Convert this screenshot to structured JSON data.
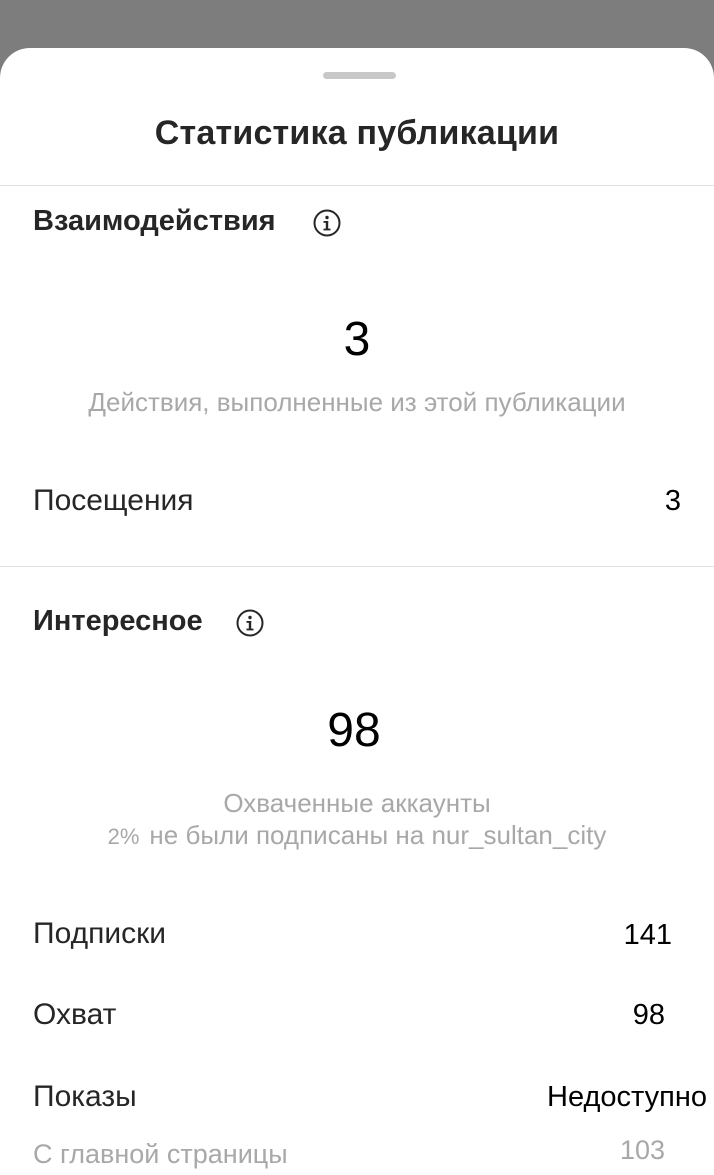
{
  "sheet": {
    "title": "Статистика публикации"
  },
  "interactions": {
    "title": "Взаимодействия",
    "info_icon": "info-circle-icon",
    "total": "3",
    "caption": "Действия, выполненные из этой публикации",
    "rows": [
      {
        "label": "Посещения",
        "value": "3"
      }
    ]
  },
  "discovery": {
    "title": "Интересное",
    "info_icon": "info-circle-icon",
    "total": "98",
    "caption_line1": "Охваченные аккаунты",
    "caption_percent": "2%",
    "caption_line2": "не были подписаны на nur_sultan_city",
    "rows": [
      {
        "label": "Подписки",
        "value": "141"
      },
      {
        "label": "Охват",
        "value": "98"
      },
      {
        "label": "Показы",
        "value": "Недоступно"
      },
      {
        "label": "С главной страницы",
        "value": "103"
      }
    ]
  }
}
